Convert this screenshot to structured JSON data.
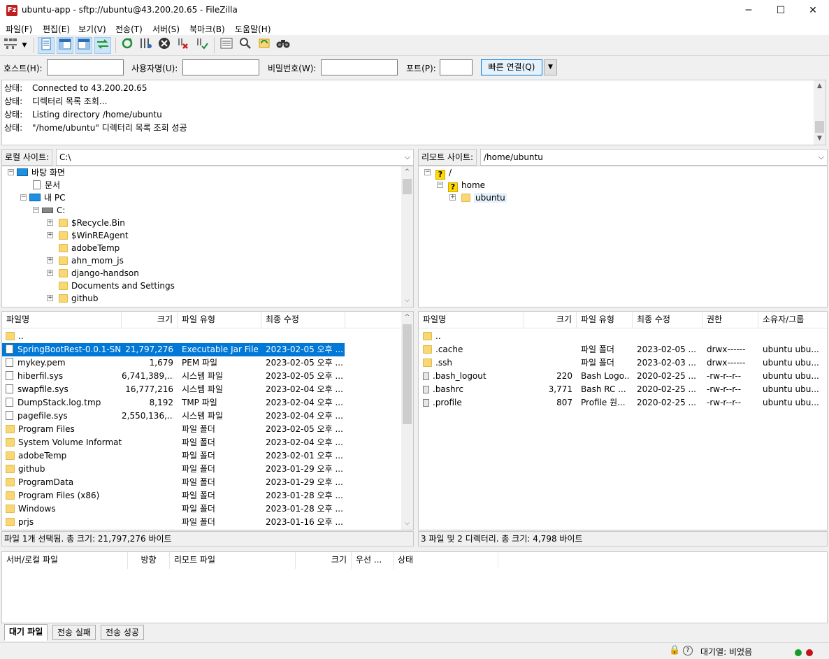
{
  "window": {
    "title": "ubuntu-app - sftp://ubuntu@43.200.20.65 - FileZilla",
    "app_icon": "Fz",
    "minimize": "─",
    "maximize": "☐",
    "close": "✕"
  },
  "menu": [
    "파일(F)",
    "편집(E)",
    "보기(V)",
    "전송(T)",
    "서버(S)",
    "북마크(B)",
    "도움말(H)"
  ],
  "toolbar_icons": [
    "site-manager-icon",
    "dropdown-arrow-icon",
    "toggle-log-icon",
    "toggle-local-tree-icon",
    "toggle-remote-tree-icon",
    "toggle-queue-icon",
    "refresh-icon",
    "process-queue-icon",
    "cancel-icon",
    "disconnect-icon",
    "reconnect-icon",
    "directory-filter-icon",
    "directory-compare-icon",
    "sync-browse-icon",
    "find-icon"
  ],
  "quickconnect": {
    "host_label": "호스트(H):",
    "host_value": "",
    "user_label": "사용자명(U):",
    "user_value": "",
    "pass_label": "비밀번호(W):",
    "pass_value": "",
    "port_label": "포트(P):",
    "port_value": "",
    "connect_label": "빠른 연결(Q)",
    "dropdown_arrow": "▼"
  },
  "log": [
    {
      "key": "상태:",
      "msg": "Connected to 43.200.20.65"
    },
    {
      "key": "상태:",
      "msg": "디렉터리 목록 조회..."
    },
    {
      "key": "상태:",
      "msg": "Listing directory /home/ubuntu"
    },
    {
      "key": "상태:",
      "msg": "\"/home/ubuntu\" 디렉터리 목록 조회 성공"
    }
  ],
  "local": {
    "site_label": "로컬 사이트:",
    "path": "C:\\",
    "tree": [
      {
        "label": "바탕 화면",
        "type": "desktop"
      },
      {
        "label": "문서",
        "type": "doc"
      },
      {
        "label": "내 PC",
        "type": "pc"
      },
      {
        "label": "C:",
        "type": "drive"
      },
      {
        "label": "$Recycle.Bin",
        "type": "folder"
      },
      {
        "label": "$WinREAgent",
        "type": "folder"
      },
      {
        "label": "adobeTemp",
        "type": "folder"
      },
      {
        "label": "ahn_mom_js",
        "type": "folder"
      },
      {
        "label": "django-handson",
        "type": "folder"
      },
      {
        "label": "Documents and Settings",
        "type": "folder"
      },
      {
        "label": "github",
        "type": "folder"
      }
    ],
    "headers": [
      "파일명",
      "크기",
      "파일 유형",
      "최종 수정"
    ],
    "files": [
      {
        "name": "..",
        "size": "",
        "type": "",
        "modified": "",
        "icon": "folder"
      },
      {
        "name": "SpringBootRest-0.0.1-SN...",
        "size": "21,797,276",
        "type": "Executable Jar File",
        "modified": "2023-02-05 오후 ...",
        "icon": "file",
        "selected": true
      },
      {
        "name": "mykey.pem",
        "size": "1,679",
        "type": "PEM 파일",
        "modified": "2023-02-05 오후 ...",
        "icon": "file"
      },
      {
        "name": "hiberfil.sys",
        "size": "6,741,389,...",
        "type": "시스템 파일",
        "modified": "2023-02-05 오후 ...",
        "icon": "file"
      },
      {
        "name": "swapfile.sys",
        "size": "16,777,216",
        "type": "시스템 파일",
        "modified": "2023-02-04 오후 ...",
        "icon": "file"
      },
      {
        "name": "DumpStack.log.tmp",
        "size": "8,192",
        "type": "TMP 파일",
        "modified": "2023-02-04 오후 ...",
        "icon": "file"
      },
      {
        "name": "pagefile.sys",
        "size": "2,550,136,...",
        "type": "시스템 파일",
        "modified": "2023-02-04 오후 ...",
        "icon": "file"
      },
      {
        "name": "Program Files",
        "size": "",
        "type": "파일 폴더",
        "modified": "2023-02-05 오후 ...",
        "icon": "folder"
      },
      {
        "name": "System Volume Informat...",
        "size": "",
        "type": "파일 폴더",
        "modified": "2023-02-04 오후 ...",
        "icon": "folder"
      },
      {
        "name": "adobeTemp",
        "size": "",
        "type": "파일 폴더",
        "modified": "2023-02-01 오후 ...",
        "icon": "folder"
      },
      {
        "name": "github",
        "size": "",
        "type": "파일 폴더",
        "modified": "2023-01-29 오후 ...",
        "icon": "folder"
      },
      {
        "name": "ProgramData",
        "size": "",
        "type": "파일 폴더",
        "modified": "2023-01-29 오후 ...",
        "icon": "folder"
      },
      {
        "name": "Program Files (x86)",
        "size": "",
        "type": "파일 폴더",
        "modified": "2023-01-28 오후 ...",
        "icon": "folder"
      },
      {
        "name": "Windows",
        "size": "",
        "type": "파일 폴더",
        "modified": "2023-01-28 오후 ...",
        "icon": "folder"
      },
      {
        "name": "prjs",
        "size": "",
        "type": "파일 폴더",
        "modified": "2023-01-16 오후 ...",
        "icon": "folder"
      }
    ],
    "status": "파일 1개 선택됨. 총 크기: 21,797,276 바이트"
  },
  "remote": {
    "site_label": "리모트 사이트:",
    "path": "/home/ubuntu",
    "tree": [
      {
        "label": "/",
        "type": "unknown"
      },
      {
        "label": "home",
        "type": "unknown"
      },
      {
        "label": "ubuntu",
        "type": "folder"
      }
    ],
    "headers": [
      "파일명",
      "크기",
      "파일 유형",
      "최종 수정",
      "권한",
      "소유자/그룹"
    ],
    "files": [
      {
        "name": "..",
        "size": "",
        "type": "",
        "modified": "",
        "perm": "",
        "owner": "",
        "icon": "folder"
      },
      {
        "name": ".cache",
        "size": "",
        "type": "파일 폴더",
        "modified": "2023-02-05 ...",
        "perm": "drwx------",
        "owner": "ubuntu ubu...",
        "icon": "folder"
      },
      {
        "name": ".ssh",
        "size": "",
        "type": "파일 폴더",
        "modified": "2023-02-03 ...",
        "perm": "drwx------",
        "owner": "ubuntu ubu...",
        "icon": "folder"
      },
      {
        "name": ".bash_logout",
        "size": "220",
        "type": "Bash Logo...",
        "modified": "2020-02-25 ...",
        "perm": "-rw-r--r--",
        "owner": "ubuntu ubu...",
        "icon": "dark"
      },
      {
        "name": ".bashrc",
        "size": "3,771",
        "type": "Bash RC ...",
        "modified": "2020-02-25 ...",
        "perm": "-rw-r--r--",
        "owner": "ubuntu ubu...",
        "icon": "dark"
      },
      {
        "name": ".profile",
        "size": "807",
        "type": "Profile 원...",
        "modified": "2020-02-25 ...",
        "perm": "-rw-r--r--",
        "owner": "ubuntu ubu...",
        "icon": "dark"
      }
    ],
    "status": "3 파일 및 2 디렉터리. 총 크기: 4,798 바이트"
  },
  "queue": {
    "headers": [
      "서버/로컬 파일",
      "방향",
      "리모트 파일",
      "크기",
      "우선 ...",
      "상태"
    ],
    "tabs": [
      "대기 파일",
      "전송 실패",
      "전송 성공"
    ]
  },
  "statusbar": {
    "queue_text": "대기열: 비었음",
    "lock_icon": "🔒",
    "key_icon": "?"
  },
  "colors": {
    "selection": "#0078d7",
    "folder": "#f8d775",
    "led_green": "#1a9a2a",
    "led_red": "#c0141c"
  }
}
